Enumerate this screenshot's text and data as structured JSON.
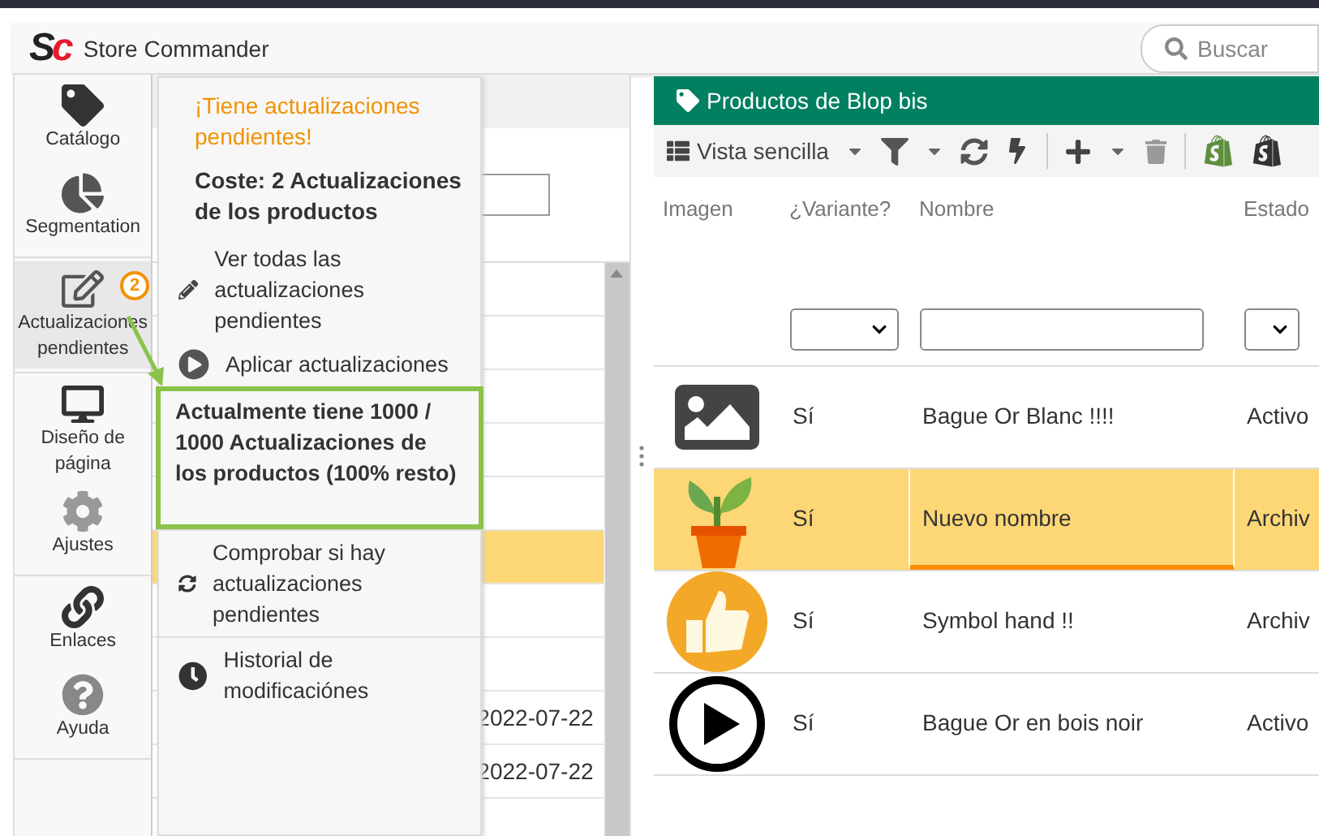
{
  "app": {
    "logo": [
      {
        "text": "S",
        "color": "#222222"
      },
      {
        "text": "c",
        "color": "#e8192c"
      }
    ],
    "title": "Store Commander",
    "search_placeholder": "Buscar"
  },
  "nav": {
    "groups": [
      [
        {
          "label": "Catálogo",
          "kind": "tag",
          "selected": false
        },
        {
          "label": "Segmentation",
          "kind": "pie",
          "selected": false
        }
      ],
      [
        {
          "label": "Actualizaciones pendientes",
          "kind": "edit",
          "selected": true,
          "badge": "2"
        }
      ],
      [
        {
          "label": "Diseño de página",
          "kind": "monitor",
          "selected": false
        },
        {
          "label": "Ajustes",
          "kind": "gear",
          "selected": false
        }
      ],
      [
        {
          "label": "Enlaces",
          "kind": "link",
          "selected": false
        },
        {
          "label": "Ayuda",
          "kind": "help",
          "selected": false
        }
      ]
    ]
  },
  "update_menu": {
    "notice": "¡Tiene actualizaciones pendientes!",
    "cost": "Coste: 2 Actualizaciones de los productos",
    "items": [
      {
        "label": "Ver todas las actualizaciones pendientes",
        "kind": "pencil"
      },
      {
        "label": "Aplicar actualizaciones",
        "kind": "play"
      },
      {
        "label": "Comprobar si hay actualizaciones pendientes",
        "kind": "refresh"
      },
      {
        "label": "Historial de modificaciónes",
        "kind": "clock"
      }
    ],
    "popup": "Actualmente tiene 1000 / 1000 Actualizaciones de los productos (100% resto)"
  },
  "middle_list": {
    "rows": [
      {
        "selected": false
      },
      {
        "selected": false
      },
      {
        "selected": false
      },
      {
        "selected": false
      },
      {
        "selected": false
      },
      {
        "selected": true
      },
      {
        "selected": false
      },
      {
        "selected": false
      },
      {
        "date": "2022-07-22",
        "selected": false
      },
      {
        "date": "2022-07-22",
        "selected": false
      }
    ]
  },
  "products": {
    "title": "Productos de Blop bis",
    "view": "Vista sencilla",
    "columns": [
      "Imagen",
      "¿Variante?",
      "Nombre",
      "Estado"
    ],
    "rows": [
      {
        "kind": "placeholder",
        "variant": "Sí",
        "name": "Bague Or Blanc !!!!",
        "status": "Activo",
        "selected": false
      },
      {
        "kind": "plant",
        "variant": "Sí",
        "name": "Nuevo nombre",
        "status": "Archiv",
        "selected": true
      },
      {
        "kind": "thumbs",
        "variant": "Sí",
        "name": "Symbol hand !!",
        "status": "Archiv",
        "selected": false
      },
      {
        "kind": "play",
        "variant": "Sí",
        "name": "Bague Or en bois noir",
        "status": "Activo",
        "selected": false
      }
    ]
  }
}
